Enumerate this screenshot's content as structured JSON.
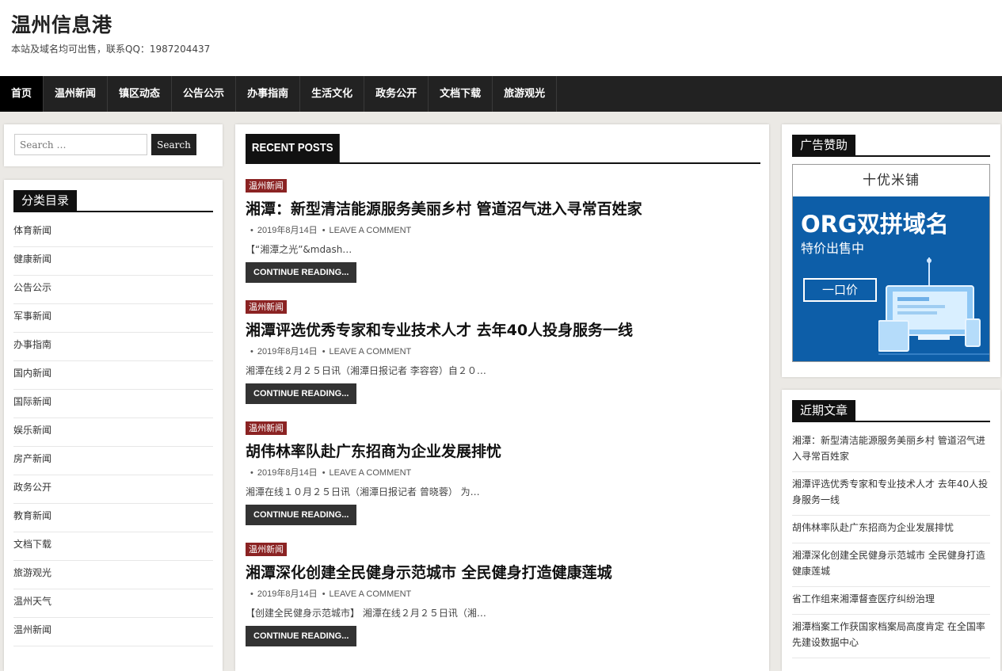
{
  "header": {
    "title": "温州信息港",
    "description": "本站及域名均可出售，联系QQ：1987204437"
  },
  "nav": {
    "items": [
      "首页",
      "温州新闻",
      "镇区动态",
      "公告公示",
      "办事指南",
      "生活文化",
      "政务公开",
      "文档下载",
      "旅游观光"
    ]
  },
  "search": {
    "placeholder": "Search …",
    "button": "Search"
  },
  "categories": {
    "title": "分类目录",
    "items": [
      "体育新闻",
      "健康新闻",
      "公告公示",
      "军事新闻",
      "办事指南",
      "国内新闻",
      "国际新闻",
      "娱乐新闻",
      "房产新闻",
      "政务公开",
      "教育新闻",
      "文档下载",
      "旅游观光",
      "温州天气",
      "温州新闻"
    ]
  },
  "main": {
    "heading": "RECENT POSTS",
    "posts": [
      {
        "category": "温州新闻",
        "title": "湘潭：新型清洁能源服务美丽乡村 管道沼气进入寻常百姓家",
        "date": "2019年8月14日",
        "comment": "Leave a comment",
        "excerpt": "【“湘潭之光”&mdash…",
        "more": "Continue reading..."
      },
      {
        "category": "温州新闻",
        "title": "湘潭评选优秀专家和专业技术人才 去年40人投身服务一线",
        "date": "2019年8月14日",
        "comment": "Leave a comment",
        "excerpt": "湘潭在线２月２５日讯（湘潭日报记者 李容容）自２０…",
        "more": "Continue reading..."
      },
      {
        "category": "温州新闻",
        "title": "胡伟林率队赴广东招商为企业发展排忧",
        "date": "2019年8月14日",
        "comment": "Leave a comment",
        "excerpt": "湘潭在线１０月２５日讯（湘潭日报记者 曾晓蓉） 为…",
        "more": "Continue reading..."
      },
      {
        "category": "温州新闻",
        "title": "湘潭深化创建全民健身示范城市 全民健身打造健康莲城",
        "date": "2019年8月14日",
        "comment": "Leave a comment",
        "excerpt": "【创建全民健身示范城市】 湘潭在线２月２５日讯（湘…",
        "more": "Continue reading..."
      }
    ]
  },
  "ad": {
    "title": "广告赞助",
    "brand": "十优米铺",
    "headline": "ORG双拼域名",
    "subline": "特价出售中",
    "button": "一口价"
  },
  "recent": {
    "title": "近期文章",
    "items": [
      "湘潭：新型清洁能源服务美丽乡村 管道沼气进入寻常百姓家",
      "湘潭评选优秀专家和专业技术人才 去年40人投身服务一线",
      "胡伟林率队赴广东招商为企业发展排忧",
      "湘潭深化创建全民健身示范城市 全民健身打造健康莲城",
      "省工作组来湘潭督查医疗纠纷治理",
      "湘潭档案工作获国家档案局高度肯定 在全国率先建设数据中心"
    ]
  },
  "colors": {
    "accent": "#8b2323",
    "nav_bg": "#222222",
    "ad_blue": "#0d5ea8"
  }
}
